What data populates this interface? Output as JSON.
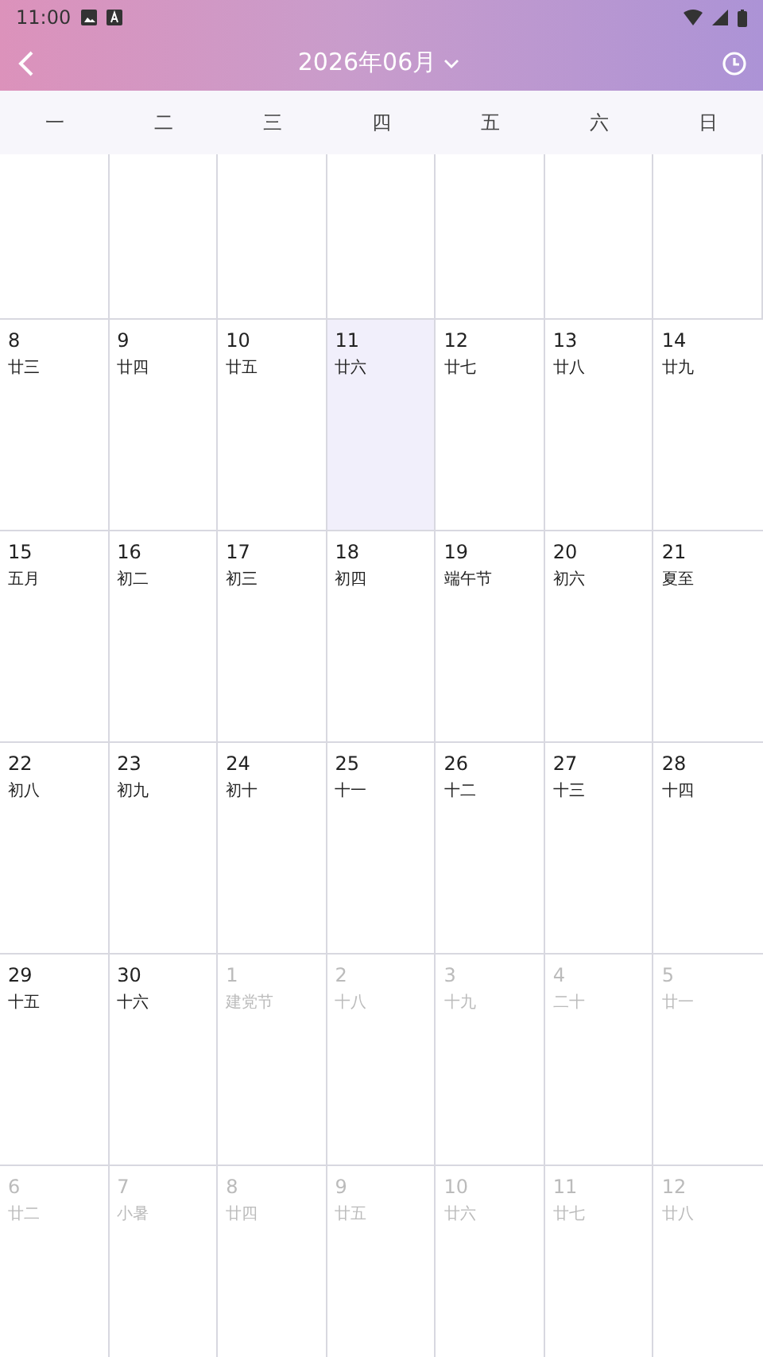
{
  "status_bar": {
    "time": "11:00"
  },
  "header": {
    "title": "2026年06月"
  },
  "weekdays": [
    "一",
    "二",
    "三",
    "四",
    "五",
    "六",
    "日"
  ],
  "weeks": [
    [
      {
        "day": "8",
        "lunar": "廿三",
        "selected": false,
        "in_month": true
      },
      {
        "day": "9",
        "lunar": "廿四",
        "selected": false,
        "in_month": true
      },
      {
        "day": "10",
        "lunar": "廿五",
        "selected": false,
        "in_month": true
      },
      {
        "day": "11",
        "lunar": "廿六",
        "selected": true,
        "in_month": true
      },
      {
        "day": "12",
        "lunar": "廿七",
        "selected": false,
        "in_month": true
      },
      {
        "day": "13",
        "lunar": "廿八",
        "selected": false,
        "in_month": true
      },
      {
        "day": "14",
        "lunar": "廿九",
        "selected": false,
        "in_month": true
      }
    ],
    [
      {
        "day": "15",
        "lunar": "五月",
        "selected": false,
        "in_month": true
      },
      {
        "day": "16",
        "lunar": "初二",
        "selected": false,
        "in_month": true
      },
      {
        "day": "17",
        "lunar": "初三",
        "selected": false,
        "in_month": true
      },
      {
        "day": "18",
        "lunar": "初四",
        "selected": false,
        "in_month": true
      },
      {
        "day": "19",
        "lunar": "端午节",
        "selected": false,
        "in_month": true
      },
      {
        "day": "20",
        "lunar": "初六",
        "selected": false,
        "in_month": true
      },
      {
        "day": "21",
        "lunar": "夏至",
        "selected": false,
        "in_month": true
      }
    ],
    [
      {
        "day": "22",
        "lunar": "初八",
        "selected": false,
        "in_month": true
      },
      {
        "day": "23",
        "lunar": "初九",
        "selected": false,
        "in_month": true
      },
      {
        "day": "24",
        "lunar": "初十",
        "selected": false,
        "in_month": true
      },
      {
        "day": "25",
        "lunar": "十一",
        "selected": false,
        "in_month": true
      },
      {
        "day": "26",
        "lunar": "十二",
        "selected": false,
        "in_month": true
      },
      {
        "day": "27",
        "lunar": "十三",
        "selected": false,
        "in_month": true
      },
      {
        "day": "28",
        "lunar": "十四",
        "selected": false,
        "in_month": true
      }
    ],
    [
      {
        "day": "29",
        "lunar": "十五",
        "selected": false,
        "in_month": true
      },
      {
        "day": "30",
        "lunar": "十六",
        "selected": false,
        "in_month": true
      },
      {
        "day": "1",
        "lunar": "建党节",
        "selected": false,
        "in_month": false
      },
      {
        "day": "2",
        "lunar": "十八",
        "selected": false,
        "in_month": false
      },
      {
        "day": "3",
        "lunar": "十九",
        "selected": false,
        "in_month": false
      },
      {
        "day": "4",
        "lunar": "二十",
        "selected": false,
        "in_month": false
      },
      {
        "day": "5",
        "lunar": "廿一",
        "selected": false,
        "in_month": false
      }
    ],
    [
      {
        "day": "6",
        "lunar": "廿二",
        "selected": false,
        "in_month": false
      },
      {
        "day": "7",
        "lunar": "小暑",
        "selected": false,
        "in_month": false
      },
      {
        "day": "8",
        "lunar": "廿四",
        "selected": false,
        "in_month": false
      },
      {
        "day": "9",
        "lunar": "廿五",
        "selected": false,
        "in_month": false
      },
      {
        "day": "10",
        "lunar": "廿六",
        "selected": false,
        "in_month": false
      },
      {
        "day": "11",
        "lunar": "廿七",
        "selected": false,
        "in_month": false
      },
      {
        "day": "12",
        "lunar": "廿八",
        "selected": false,
        "in_month": false
      }
    ]
  ]
}
